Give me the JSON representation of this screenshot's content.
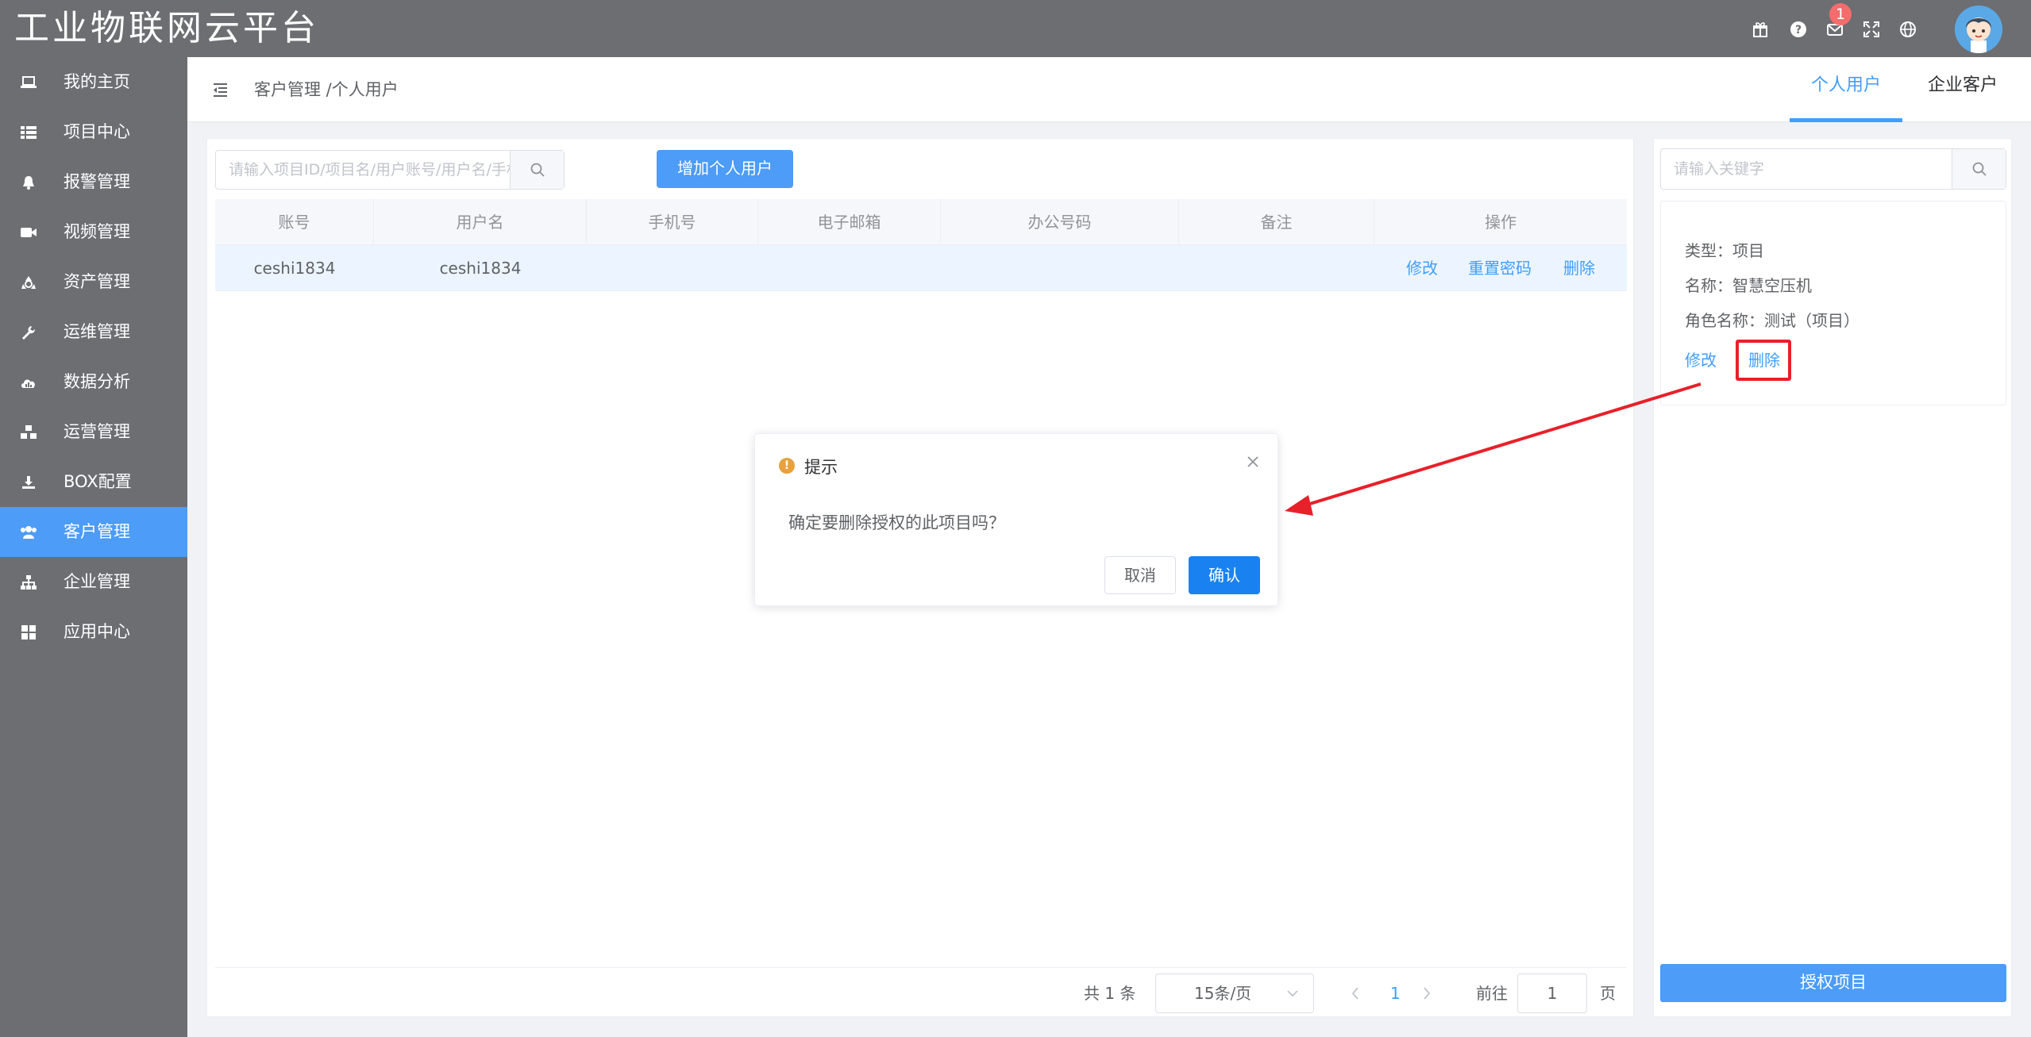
{
  "app": {
    "title": "工业物联网云平台"
  },
  "header": {
    "notification_count": "1"
  },
  "sidebar": {
    "items": [
      {
        "label": "我的主页",
        "icon": "laptop-icon"
      },
      {
        "label": "项目中心",
        "icon": "list-icon"
      },
      {
        "label": "报警管理",
        "icon": "bell-icon"
      },
      {
        "label": "视频管理",
        "icon": "video-camera-icon"
      },
      {
        "label": "资产管理",
        "icon": "recycle-icon"
      },
      {
        "label": "运维管理",
        "icon": "wrench-icon"
      },
      {
        "label": "数据分析",
        "icon": "cloud-chart-icon"
      },
      {
        "label": "运营管理",
        "icon": "cubes-icon"
      },
      {
        "label": "BOX配置",
        "icon": "download-icon"
      },
      {
        "label": "客户管理",
        "icon": "users-icon"
      },
      {
        "label": "企业管理",
        "icon": "sitemap-icon"
      },
      {
        "label": "应用中心",
        "icon": "grid-icon"
      }
    ],
    "active_index": 9
  },
  "topbar": {
    "breadcrumb": "客户管理 /个人用户",
    "tabs": [
      {
        "label": "个人用户"
      },
      {
        "label": "企业客户"
      }
    ],
    "active_tab": 0
  },
  "main": {
    "search_placeholder": "请输入项目ID/项目名/用户账号/用户名/手机号/邮",
    "add_button": "增加个人用户",
    "columns": [
      "账号",
      "用户名",
      "手机号",
      "电子邮箱",
      "办公号码",
      "备注",
      "操作"
    ],
    "rows": [
      {
        "account": "ceshi1834",
        "username": "ceshi1834",
        "phone": "",
        "email": "",
        "office": "",
        "remark": ""
      }
    ],
    "row_actions": {
      "edit": "修改",
      "reset_password": "重置密码",
      "delete": "删除"
    },
    "pagination": {
      "total": "共 1 条",
      "page_size": "15条/页",
      "current_page": "1",
      "goto_label": "前往",
      "goto_value": "1",
      "page_suffix": "页"
    }
  },
  "right_panel": {
    "search_placeholder": "请输入关键字",
    "card": {
      "type": "类型：项目",
      "name": "名称：智慧空压机",
      "role": "角色名称：测试（项目）",
      "edit": "修改",
      "delete": "删除"
    },
    "authorize_button": "授权项目"
  },
  "dialog": {
    "title": "提示",
    "message": "确定要删除授权的此项目吗？",
    "cancel": "取消",
    "confirm": "确认"
  },
  "colors": {
    "header_bg": "#6c6e72",
    "accent": "#409eff",
    "primary_button": "#4c9cf8",
    "confirm_button": "#1a82f0",
    "highlight_red": "#e8202a",
    "warning": "#e6a23c"
  }
}
